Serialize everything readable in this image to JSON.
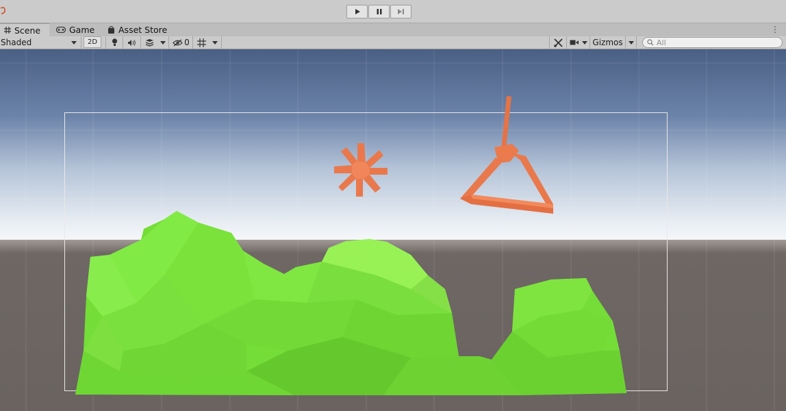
{
  "playbar": {
    "play_icon": "play-icon",
    "pause_icon": "pause-icon",
    "step_icon": "step-icon"
  },
  "tabs": [
    {
      "label": "Scene",
      "icon": "grid-icon",
      "active": true
    },
    {
      "label": "Game",
      "icon": "gamepad-icon",
      "active": false
    },
    {
      "label": "Asset Store",
      "icon": "shopping-bag-icon",
      "active": false
    }
  ],
  "toolbar": {
    "shading_mode": "Shaded",
    "mode_2d_label": "2D",
    "hidden_count": "0",
    "gizmos_label": "Gizmos",
    "search_placeholder": "All"
  },
  "colors": {
    "sky_top": "#4a5f84",
    "sky_horizon": "#f3f5f8",
    "ground": "#6c6562",
    "terrain": "#76e03a",
    "objects": "#e9794c",
    "camera_frame": "#e8e8e8"
  }
}
